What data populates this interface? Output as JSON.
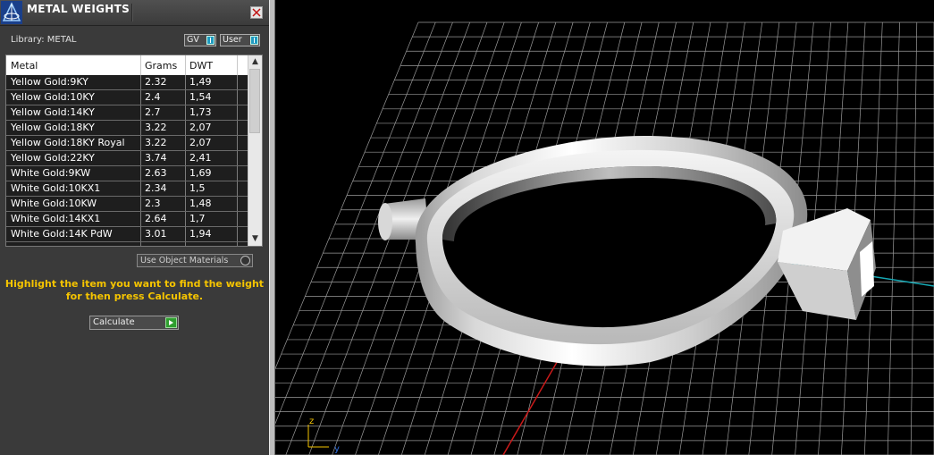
{
  "panel": {
    "title": "METAL WEIGHTS",
    "library_label": "Library: METAL",
    "toggle_gv": "GV",
    "toggle_user": "User",
    "columns": [
      "Metal",
      "Grams",
      "DWT"
    ],
    "rows": [
      {
        "metal": "Yellow Gold:9KY",
        "grams": "2.32",
        "dwt": "1,49"
      },
      {
        "metal": "Yellow Gold:10KY",
        "grams": "2.4",
        "dwt": "1,54"
      },
      {
        "metal": "Yellow Gold:14KY",
        "grams": "2.7",
        "dwt": "1,73"
      },
      {
        "metal": "Yellow Gold:18KY",
        "grams": "3.22",
        "dwt": "2,07"
      },
      {
        "metal": "Yellow Gold:18KY Royal",
        "grams": "3.22",
        "dwt": "2,07"
      },
      {
        "metal": "Yellow Gold:22KY",
        "grams": "3.74",
        "dwt": "2,41"
      },
      {
        "metal": "White Gold:9KW",
        "grams": "2.63",
        "dwt": "1,69"
      },
      {
        "metal": "White Gold:10KX1",
        "grams": "2.34",
        "dwt": "1,5"
      },
      {
        "metal": "White Gold:10KW",
        "grams": "2.3",
        "dwt": "1,48"
      },
      {
        "metal": "White Gold:14KX1",
        "grams": "2.64",
        "dwt": "1,7"
      },
      {
        "metal": "White Gold:14K PdW",
        "grams": "3.01",
        "dwt": "1,94"
      }
    ],
    "use_object_materials": "Use Object Materials",
    "hint_line1": "Highlight the item you want to find the weight",
    "hint_line2": "for then press Calculate.",
    "calculate_label": "Calculate"
  },
  "viewport": {
    "axis_z": "z",
    "axis_y": "y",
    "colors": {
      "grid": "#9a9a9a",
      "x_axis": "#cc1a1a",
      "y_axis": "#16a8b4",
      "hint": "#f5c400"
    }
  }
}
